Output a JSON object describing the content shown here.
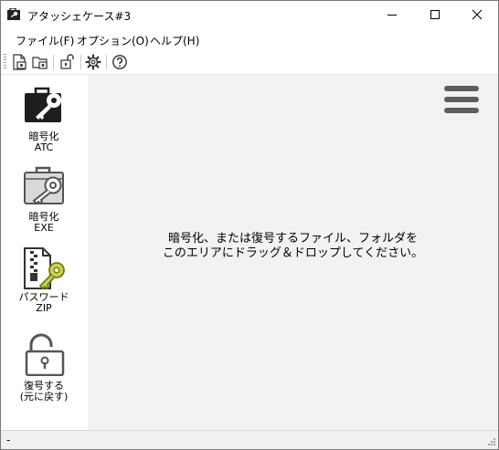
{
  "window": {
    "title": "アタッシェケース#3"
  },
  "menu": {
    "items": [
      "ファイル(F)",
      "オプション(O)",
      "ヘルプ(H)"
    ]
  },
  "toolbar": {
    "buttons": [
      "encrypt-file-icon",
      "encrypt-folder-icon",
      "decrypt-icon",
      "settings-gear-icon",
      "help-icon"
    ]
  },
  "sidebar": {
    "items": [
      {
        "label": "暗号化\nATC",
        "icon": "briefcase-key-icon"
      },
      {
        "label": "暗号化\nEXE",
        "icon": "case-key-icon"
      },
      {
        "label": "パスワード\nZIP",
        "icon": "zip-key-icon"
      },
      {
        "label": "復号する\n(元に戻す)",
        "icon": "unlock-icon"
      }
    ]
  },
  "main": {
    "drop_message": "暗号化、または復号するファイル、フォルダを\nこのエリアにドラッグ＆ドロップしてください。"
  },
  "status": {
    "text": "-"
  },
  "colors": {
    "drop_area_bg": "#f2f2f2",
    "hamburger": "#5d5d5d"
  }
}
